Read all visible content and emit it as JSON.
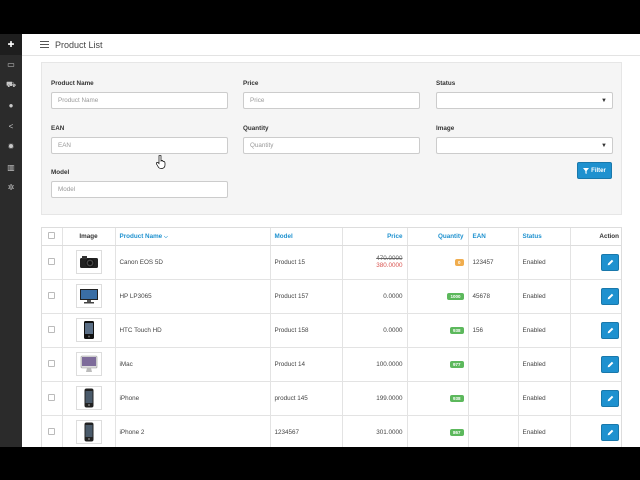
{
  "page": {
    "title": "Product List"
  },
  "sidebar": {
    "items": [
      {
        "icon": "puzzle-icon",
        "glyph": "✚"
      },
      {
        "icon": "monitor-icon",
        "glyph": "▭"
      },
      {
        "icon": "cart-icon",
        "glyph": "⛟"
      },
      {
        "icon": "user-icon",
        "glyph": "●"
      },
      {
        "icon": "share-icon",
        "glyph": "<"
      },
      {
        "icon": "gear-icon",
        "glyph": "✹"
      },
      {
        "icon": "bar-chart-icon",
        "glyph": "▥"
      },
      {
        "icon": "cogs-icon",
        "glyph": "✲"
      }
    ]
  },
  "filter": {
    "product_name": {
      "label": "Product Name",
      "placeholder": "Product Name"
    },
    "price": {
      "label": "Price",
      "placeholder": "Price"
    },
    "status": {
      "label": "Status",
      "value": ""
    },
    "ean": {
      "label": "EAN",
      "placeholder": "EAN"
    },
    "quantity": {
      "label": "Quantity",
      "placeholder": "Quantity"
    },
    "image": {
      "label": "Image",
      "value": ""
    },
    "model": {
      "label": "Model",
      "placeholder": "Model"
    },
    "button": "Filter"
  },
  "table": {
    "headers": {
      "image": "Image",
      "product_name": "Product Name",
      "model": "Model",
      "price": "Price",
      "quantity": "Quantity",
      "ean": "EAN",
      "status": "Status",
      "action": "Action"
    },
    "rows": [
      {
        "name": "Canon EOS 5D",
        "model": "Product 15",
        "price": "470.0000",
        "special": "380.0000",
        "quantity": "0",
        "qty_color": "#f0ad4e",
        "ean": "123457",
        "status": "Enabled",
        "thumb": "camera"
      },
      {
        "name": "HP LP3065",
        "model": "Product 157",
        "price": "0.0000",
        "special": "",
        "quantity": "1000",
        "qty_color": "#5cb85c",
        "ean": "45678",
        "status": "Enabled",
        "thumb": "monitor"
      },
      {
        "name": "HTC Touch HD",
        "model": "Product 158",
        "price": "0.0000",
        "special": "",
        "quantity": "938",
        "qty_color": "#5cb85c",
        "ean": "156",
        "status": "Enabled",
        "thumb": "phone"
      },
      {
        "name": "iMac",
        "model": "Product 14",
        "price": "100.0000",
        "special": "",
        "quantity": "977",
        "qty_color": "#5cb85c",
        "ean": "",
        "status": "Enabled",
        "thumb": "imac"
      },
      {
        "name": "iPhone",
        "model": "product 145",
        "price": "199.0000",
        "special": "",
        "quantity": "938",
        "qty_color": "#5cb85c",
        "ean": "",
        "status": "Enabled",
        "thumb": "iphone"
      },
      {
        "name": "iPhone 2",
        "model": "1234567",
        "price": "301.0000",
        "special": "",
        "quantity": "867",
        "qty_color": "#5cb85c",
        "ean": "",
        "status": "Enabled",
        "thumb": "iphone"
      }
    ]
  },
  "colors": {
    "primary": "#1e91cf",
    "warning": "#f0ad4e",
    "success": "#5cb85c",
    "danger": "#d9534f",
    "sidebar": "#2b2b2b"
  }
}
